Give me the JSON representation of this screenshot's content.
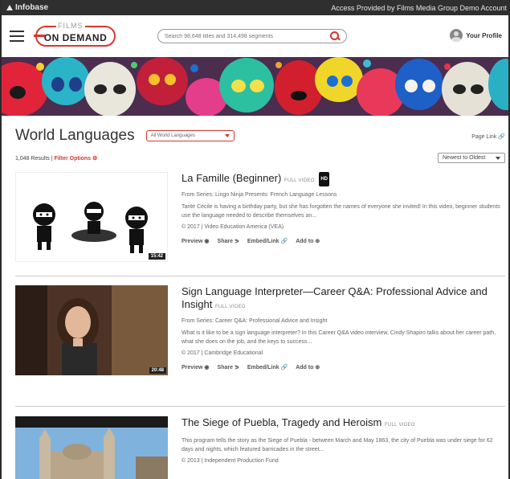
{
  "topbar": {
    "brand": "Infobase",
    "access": "Access Provided by Films Media Group Demo Account"
  },
  "header": {
    "logo_small": "FILMS",
    "logo_main": "ON DEMAND",
    "search_placeholder": "Search 98,648 titles and 314,498 segments",
    "profile_label": "Your Profile"
  },
  "page": {
    "title": "World Languages",
    "language_select": "All World Languages",
    "page_link": "Page Link",
    "results_count": "1,048 Results |",
    "filter_options": "Filter Options",
    "sort_label": "Newest to Oldest"
  },
  "results": [
    {
      "title": "La Famille (Beginner)",
      "badge": "FULL VIDEO",
      "hd": "HD",
      "series": "From Series: Lingo Ninja Presents: French Language Lessons",
      "description": "Tante Cécile is having a birthday party, but she has forgotten the names of everyone she invited! In this video, beginner students use the language needed to describe themselves an...",
      "meta": "© 2017 | Video Education America (VEA)",
      "duration": "15:42",
      "actions": [
        "Preview",
        "Share",
        "Embed/Link",
        "Add to"
      ]
    },
    {
      "title": "Sign Language Interpreter—Career Q&A: Professional Advice and Insight",
      "badge": "FULL VIDEO",
      "series": "From Series: Career Q&A: Professional Advice and Insight",
      "description": "What is it like to be a sign language interpreter? In this Career Q&A video interview, Cindy Shapiro talks about her career path, what she does on the job, and the keys to success...",
      "meta": "© 2017 | Cambridge Educational",
      "duration": "20:48",
      "actions": [
        "Preview",
        "Share",
        "Embed/Link",
        "Add to"
      ]
    },
    {
      "title": "The Siege of Puebla, Tragedy and Heroism",
      "badge": "FULL VIDEO",
      "description": "This program tells the story as the Siege of Puebla - between March and May 1863, the city of Puebla was under siege for 62 days and nights, which featured barricades in the street...",
      "meta": "© 2013 | Independent Production Fund"
    }
  ],
  "colors": {
    "accent": "#d7382e",
    "topbar": "#2f2f2f"
  }
}
